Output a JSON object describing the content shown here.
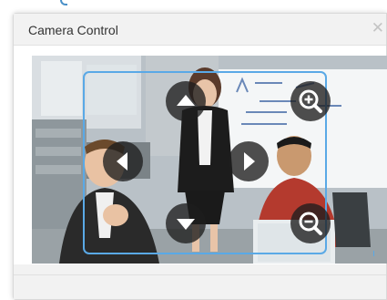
{
  "dialog": {
    "title": "Camera Control",
    "close_symbol": "✕"
  },
  "video": {
    "description_icon": "camera-feed",
    "controls": [
      {
        "name": "pan-up",
        "icon": "triangle-up-icon"
      },
      {
        "name": "pan-left",
        "icon": "triangle-left-icon"
      },
      {
        "name": "pan-right",
        "icon": "triangle-right-icon"
      },
      {
        "name": "pan-down",
        "icon": "triangle-down-icon"
      },
      {
        "name": "zoom-in",
        "icon": "zoom-in-icon"
      },
      {
        "name": "zoom-out",
        "icon": "zoom-out-icon"
      }
    ]
  },
  "colors": {
    "accent": "#5aa9e6",
    "control_bg": "#1e1e1e"
  }
}
